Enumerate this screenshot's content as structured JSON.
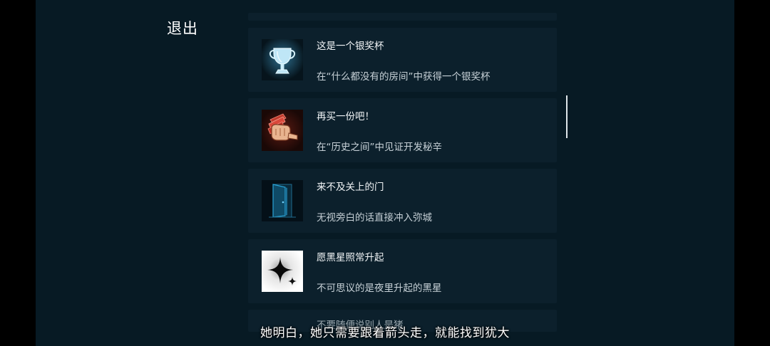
{
  "header": {
    "exit_label": "退出"
  },
  "achievements": [
    {
      "title": "这是一个银奖杯",
      "description": "在“什么都没有的房间”中获得一个银奖杯",
      "icon": "trophy-icon"
    },
    {
      "title": "再买一份吧！",
      "description": "在“历史之间”中见证开发秘辛",
      "icon": "fist-with-cash-icon"
    },
    {
      "title": "来不及关上的门",
      "description": "无视旁白的话直接冲入弥城",
      "icon": "open-door-icon"
    },
    {
      "title": "愿黑星照常升起",
      "description": "不可思议的是夜里升起的黑星",
      "icon": "black-star-icon"
    },
    {
      "title": "不要随便说别人是猪",
      "description": "",
      "icon": "unknown-icon"
    }
  ],
  "subtitle": {
    "text": "她明白，她只需要跟着箭头走，就能找到犹大"
  },
  "colors": {
    "background": "#071a24",
    "card": "#0c202c",
    "letterbox": "#000000",
    "text_primary": "#f2f5f7",
    "text_secondary": "#c7d1d7"
  }
}
